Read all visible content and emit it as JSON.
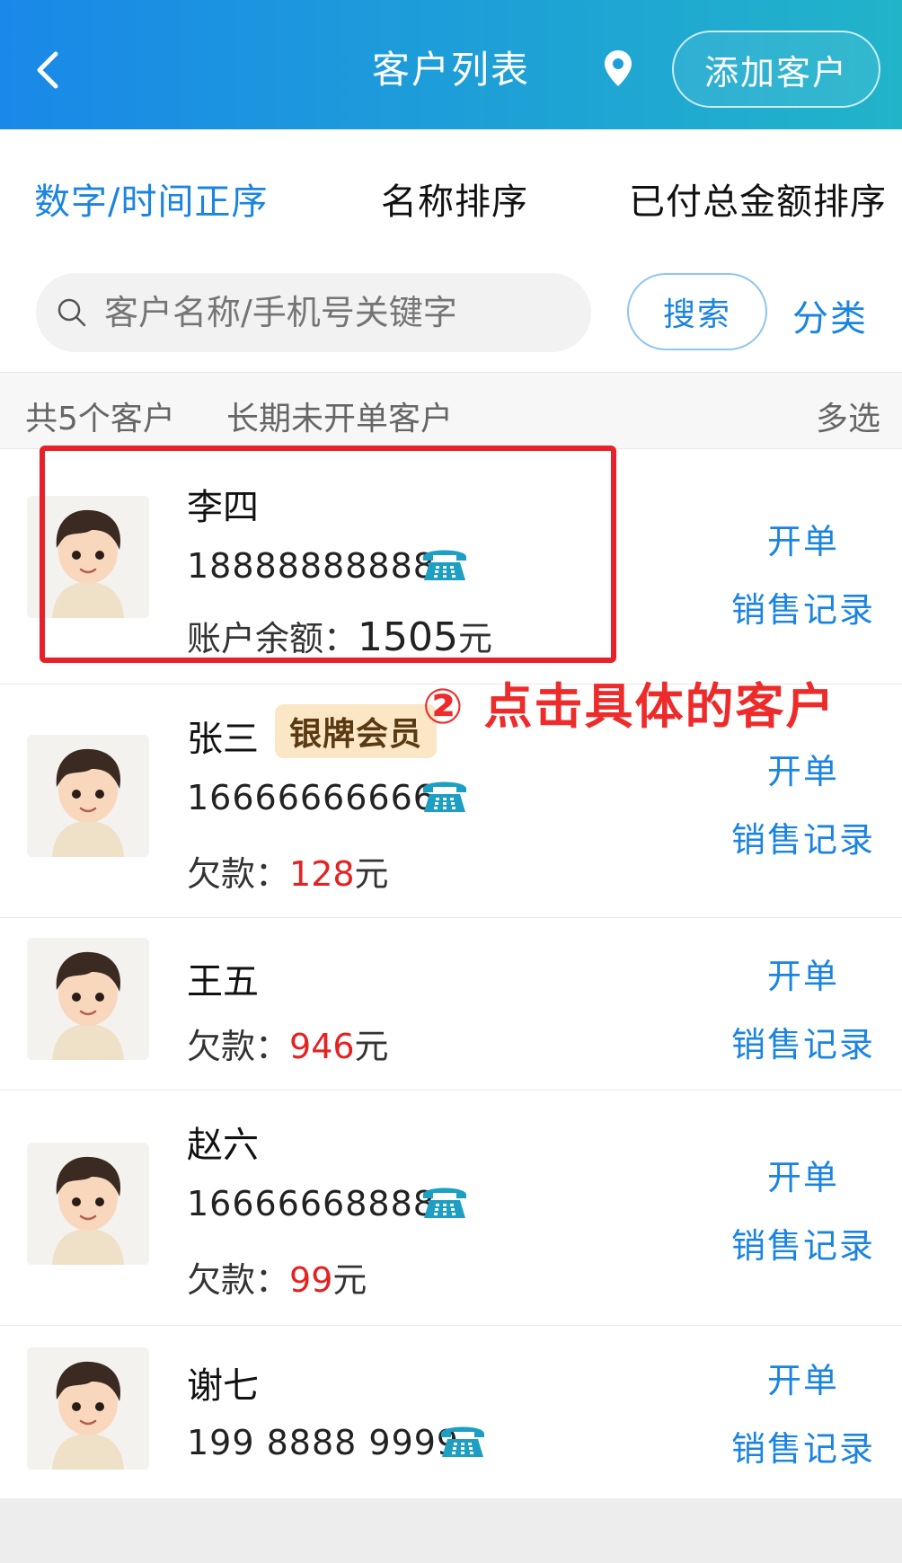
{
  "header": {
    "title": "客户列表",
    "add_button": "添加客户"
  },
  "sort_tabs": [
    {
      "label": "数字/时间正序",
      "active": true
    },
    {
      "label": "名称排序",
      "active": false
    },
    {
      "label": "已付总金额排序",
      "active": false
    }
  ],
  "search": {
    "placeholder": "客户名称/手机号关键字",
    "button": "搜索",
    "category": "分类"
  },
  "summary": {
    "count": "共5个客户",
    "long_term": "长期未开单客户",
    "multi_select": "多选"
  },
  "customers": [
    {
      "name": "李四",
      "phone": "18888888888",
      "info_label": "账户余额：",
      "info_amount": "1505",
      "info_unit": "元",
      "open": "开单",
      "sales": "销售记录"
    },
    {
      "name": "张三",
      "badge": "银牌会员",
      "phone": "16666666666",
      "info_label": "欠款：",
      "info_amount": "128",
      "info_unit": "元",
      "open": "开单",
      "sales": "销售记录"
    },
    {
      "name": "王五",
      "info_label": "欠款：",
      "info_amount": "946",
      "info_unit": "元",
      "open": "开单",
      "sales": "销售记录"
    },
    {
      "name": "赵六",
      "phone": "16666668888",
      "info_label": "欠款：",
      "info_amount": "99",
      "info_unit": "元",
      "open": "开单",
      "sales": "销售记录"
    },
    {
      "name": "谢七",
      "phone": "199 8888 9999",
      "open": "开单",
      "sales": "销售记录"
    }
  ],
  "annotation": {
    "text": "② 点击具体的客户",
    "color": "#ee2b2b"
  },
  "colors": {
    "accent": "#1a84e0",
    "debt": "#e52222",
    "header_start": "#1a88e8",
    "header_end": "#21b4c9"
  }
}
